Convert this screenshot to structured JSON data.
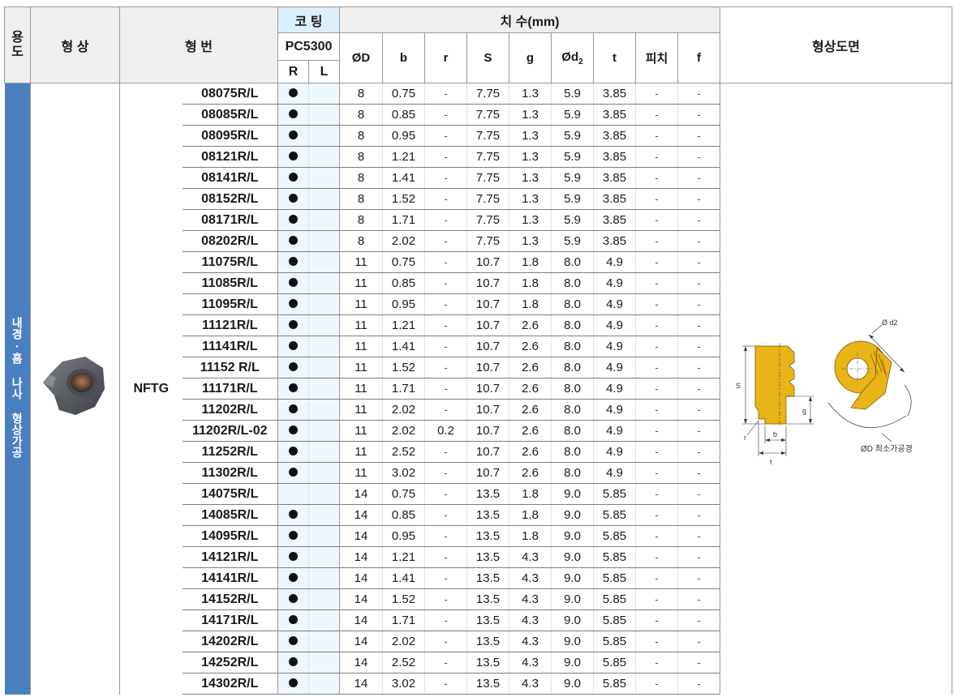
{
  "header": {
    "usage": "용도",
    "shape": "형 상",
    "model": "형 번",
    "coating": "코 팅",
    "grade": "PC5300",
    "coat_r": "R",
    "coat_l": "L",
    "dims": "치 수(mm)",
    "drawing": "형상도면",
    "cols": {
      "D": "ØD",
      "b": "b",
      "r": "r",
      "S": "S",
      "g": "g",
      "d2_main": "Ød",
      "d2_sub": "2",
      "t": "t",
      "pitch": "피치",
      "f": "f"
    }
  },
  "usage_text": "내경·홈 나사 형상가공",
  "series": "NFTG",
  "drawing_labels": {
    "S": "S",
    "g": "g",
    "r": "r",
    "b": "b",
    "t": "t",
    "d2": "Ø d2",
    "min_bore": "ØD 최소가공경"
  },
  "rows": [
    {
      "model": "08075R/L",
      "R": true,
      "L": false,
      "D": "8",
      "b": "0.75",
      "r": "-",
      "S": "7.75",
      "g": "1.3",
      "d2": "5.9",
      "t": "3.85",
      "pitch": "-",
      "f": "-"
    },
    {
      "model": "08085R/L",
      "R": true,
      "L": false,
      "D": "8",
      "b": "0.85",
      "r": "-",
      "S": "7.75",
      "g": "1.3",
      "d2": "5.9",
      "t": "3.85",
      "pitch": "-",
      "f": "-"
    },
    {
      "model": "08095R/L",
      "R": true,
      "L": false,
      "D": "8",
      "b": "0.95",
      "r": "-",
      "S": "7.75",
      "g": "1.3",
      "d2": "5.9",
      "t": "3.85",
      "pitch": "-",
      "f": "-"
    },
    {
      "model": "08121R/L",
      "R": true,
      "L": false,
      "D": "8",
      "b": "1.21",
      "r": "-",
      "S": "7.75",
      "g": "1.3",
      "d2": "5.9",
      "t": "3.85",
      "pitch": "-",
      "f": "-"
    },
    {
      "model": "08141R/L",
      "R": true,
      "L": false,
      "D": "8",
      "b": "1.41",
      "r": "-",
      "S": "7.75",
      "g": "1.3",
      "d2": "5.9",
      "t": "3.85",
      "pitch": "-",
      "f": "-"
    },
    {
      "model": "08152R/L",
      "R": true,
      "L": false,
      "D": "8",
      "b": "1.52",
      "r": "-",
      "S": "7.75",
      "g": "1.3",
      "d2": "5.9",
      "t": "3.85",
      "pitch": "-",
      "f": "-"
    },
    {
      "model": "08171R/L",
      "R": true,
      "L": false,
      "D": "8",
      "b": "1.71",
      "r": "-",
      "S": "7.75",
      "g": "1.3",
      "d2": "5.9",
      "t": "3.85",
      "pitch": "-",
      "f": "-"
    },
    {
      "model": "08202R/L",
      "R": true,
      "L": false,
      "D": "8",
      "b": "2.02",
      "r": "-",
      "S": "7.75",
      "g": "1.3",
      "d2": "5.9",
      "t": "3.85",
      "pitch": "-",
      "f": "-"
    },
    {
      "model": "11075R/L",
      "R": true,
      "L": false,
      "D": "11",
      "b": "0.75",
      "r": "-",
      "S": "10.7",
      "g": "1.8",
      "d2": "8.0",
      "t": "4.9",
      "pitch": "-",
      "f": "-"
    },
    {
      "model": "11085R/L",
      "R": true,
      "L": false,
      "D": "11",
      "b": "0.85",
      "r": "-",
      "S": "10.7",
      "g": "1.8",
      "d2": "8.0",
      "t": "4.9",
      "pitch": "-",
      "f": "-"
    },
    {
      "model": "11095R/L",
      "R": true,
      "L": false,
      "D": "11",
      "b": "0.95",
      "r": "-",
      "S": "10.7",
      "g": "1.8",
      "d2": "8.0",
      "t": "4.9",
      "pitch": "-",
      "f": "-"
    },
    {
      "model": "11121R/L",
      "R": true,
      "L": false,
      "D": "11",
      "b": "1.21",
      "r": "-",
      "S": "10.7",
      "g": "2.6",
      "d2": "8.0",
      "t": "4.9",
      "pitch": "-",
      "f": "-"
    },
    {
      "model": "11141R/L",
      "R": true,
      "L": false,
      "D": "11",
      "b": "1.41",
      "r": "-",
      "S": "10.7",
      "g": "2.6",
      "d2": "8.0",
      "t": "4.9",
      "pitch": "-",
      "f": "-"
    },
    {
      "model": "11152 R/L",
      "R": true,
      "L": false,
      "D": "11",
      "b": "1.52",
      "r": "-",
      "S": "10.7",
      "g": "2.6",
      "d2": "8.0",
      "t": "4.9",
      "pitch": "-",
      "f": "-"
    },
    {
      "model": "11171R/L",
      "R": true,
      "L": false,
      "D": "11",
      "b": "1.71",
      "r": "-",
      "S": "10.7",
      "g": "2.6",
      "d2": "8.0",
      "t": "4.9",
      "pitch": "-",
      "f": "-"
    },
    {
      "model": "11202R/L",
      "R": true,
      "L": false,
      "D": "11",
      "b": "2.02",
      "r": "-",
      "S": "10.7",
      "g": "2.6",
      "d2": "8.0",
      "t": "4.9",
      "pitch": "-",
      "f": "-"
    },
    {
      "model": "11202R/L-02",
      "R": true,
      "L": false,
      "D": "11",
      "b": "2.02",
      "r": "0.2",
      "S": "10.7",
      "g": "2.6",
      "d2": "8.0",
      "t": "4.9",
      "pitch": "-",
      "f": "-"
    },
    {
      "model": "11252R/L",
      "R": true,
      "L": false,
      "D": "11",
      "b": "2.52",
      "r": "-",
      "S": "10.7",
      "g": "2.6",
      "d2": "8.0",
      "t": "4.9",
      "pitch": "-",
      "f": "-"
    },
    {
      "model": "11302R/L",
      "R": true,
      "L": false,
      "D": "11",
      "b": "3.02",
      "r": "-",
      "S": "10.7",
      "g": "2.6",
      "d2": "8.0",
      "t": "4.9",
      "pitch": "-",
      "f": "-"
    },
    {
      "model": "14075R/L",
      "R": false,
      "L": false,
      "D": "14",
      "b": "0.75",
      "r": "-",
      "S": "13.5",
      "g": "1.8",
      "d2": "9.0",
      "t": "5.85",
      "pitch": "-",
      "f": "-"
    },
    {
      "model": "14085R/L",
      "R": true,
      "L": false,
      "D": "14",
      "b": "0.85",
      "r": "-",
      "S": "13.5",
      "g": "1.8",
      "d2": "9.0",
      "t": "5.85",
      "pitch": "-",
      "f": "-"
    },
    {
      "model": "14095R/L",
      "R": true,
      "L": false,
      "D": "14",
      "b": "0.95",
      "r": "-",
      "S": "13.5",
      "g": "1.8",
      "d2": "9.0",
      "t": "5.85",
      "pitch": "-",
      "f": "-"
    },
    {
      "model": "14121R/L",
      "R": true,
      "L": false,
      "D": "14",
      "b": "1.21",
      "r": "-",
      "S": "13.5",
      "g": "4.3",
      "d2": "9.0",
      "t": "5.85",
      "pitch": "-",
      "f": "-"
    },
    {
      "model": "14141R/L",
      "R": true,
      "L": false,
      "D": "14",
      "b": "1.41",
      "r": "-",
      "S": "13.5",
      "g": "4.3",
      "d2": "9.0",
      "t": "5.85",
      "pitch": "-",
      "f": "-"
    },
    {
      "model": "14152R/L",
      "R": true,
      "L": false,
      "D": "14",
      "b": "1.52",
      "r": "-",
      "S": "13.5",
      "g": "4.3",
      "d2": "9.0",
      "t": "5.85",
      "pitch": "-",
      "f": "-"
    },
    {
      "model": "14171R/L",
      "R": true,
      "L": false,
      "D": "14",
      "b": "1.71",
      "r": "-",
      "S": "13.5",
      "g": "4.3",
      "d2": "9.0",
      "t": "5.85",
      "pitch": "-",
      "f": "-"
    },
    {
      "model": "14202R/L",
      "R": true,
      "L": false,
      "D": "14",
      "b": "2.02",
      "r": "-",
      "S": "13.5",
      "g": "4.3",
      "d2": "9.0",
      "t": "5.85",
      "pitch": "-",
      "f": "-"
    },
    {
      "model": "14252R/L",
      "R": true,
      "L": false,
      "D": "14",
      "b": "2.52",
      "r": "-",
      "S": "13.5",
      "g": "4.3",
      "d2": "9.0",
      "t": "5.85",
      "pitch": "-",
      "f": "-"
    },
    {
      "model": "14302R/L",
      "R": true,
      "L": false,
      "D": "14",
      "b": "3.02",
      "r": "-",
      "S": "13.5",
      "g": "4.3",
      "d2": "9.0",
      "t": "5.85",
      "pitch": "-",
      "f": "-"
    }
  ],
  "colors": {
    "usage_band": "#4a7fbf",
    "coating_header": "#dcefff",
    "insert_gold": "#e8b417",
    "insert_gray": "#5a5c62"
  }
}
